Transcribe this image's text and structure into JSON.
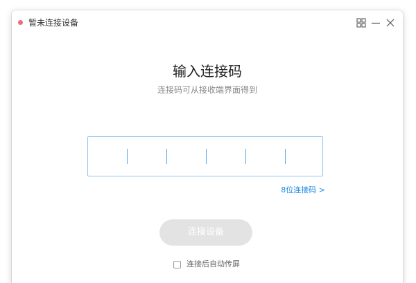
{
  "window": {
    "title": "暂未连接设备",
    "status_color": "#f26b7a",
    "controls": {
      "layout_icon": "grid-icon",
      "minimize_icon": "minimize-icon",
      "close_icon": "close-icon"
    }
  },
  "main": {
    "heading": "输入连接码",
    "subtitle": "连接码可从接收端界面得到",
    "code_input": {
      "digits": [
        "",
        "",
        "",
        "",
        "",
        ""
      ],
      "cursor_color": "#5aa9e6",
      "border_color": "#8fc4f0"
    },
    "code_length_link": "8位连接码 >",
    "connect_button": {
      "label": "连接设备",
      "enabled": false
    },
    "auto_cast": {
      "label": "连接后自动传屏",
      "checked": false
    }
  },
  "colors": {
    "accent": "#1e88e5",
    "disabled_button": "#e3e3e3"
  }
}
